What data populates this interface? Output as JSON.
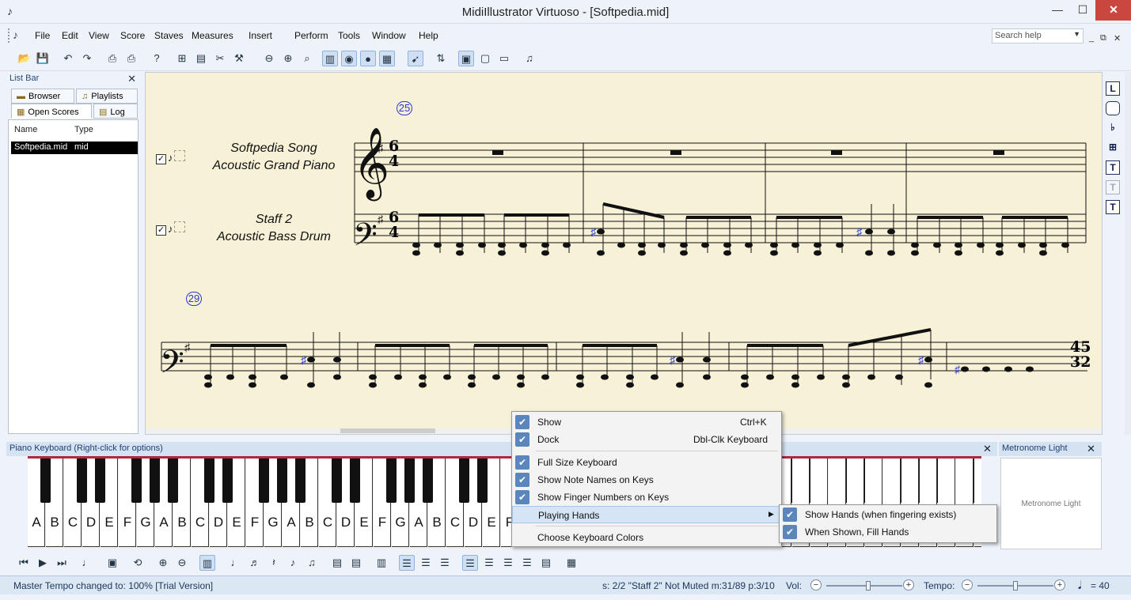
{
  "window": {
    "title": "MidiIllustrator Virtuoso - [Softpedia.mid]",
    "minimize": "—",
    "maximize": "☐",
    "close": "✕"
  },
  "menu": {
    "items": [
      "File",
      "Edit",
      "View",
      "Score",
      "Staves",
      "Measures",
      "Insert",
      "Perform",
      "Tools",
      "Window",
      "Help"
    ],
    "search_placeholder": "Search help",
    "mdi_min": "_",
    "mdi_restore": "⧉",
    "mdi_close": "✕"
  },
  "list_bar": {
    "title": "List Bar",
    "tabs": [
      "Browser",
      "Playlists",
      "Open Scores",
      "Log"
    ],
    "columns": [
      "Name",
      "Type"
    ],
    "rows": [
      {
        "name": "Softpedia.mid",
        "type": "mid"
      }
    ]
  },
  "score": {
    "measure_numbers": [
      "25",
      "29"
    ],
    "staff1_name": "Softpedia Song",
    "staff1_instrument": "Acoustic Grand Piano",
    "staff2_name": "Staff 2",
    "staff2_instrument": "Acoustic Bass Drum",
    "time_sig_top": "6",
    "time_sig_bottom": "4",
    "end_time_top": "45",
    "end_time_bottom": "32"
  },
  "keyboard_panel": {
    "title": "Piano Keyboard (Right-click for options)",
    "white_key_names": [
      "A",
      "B",
      "C",
      "D",
      "E",
      "F",
      "G",
      "A",
      "B",
      "C",
      "D",
      "E",
      "F",
      "G",
      "A",
      "B",
      "C",
      "D",
      "E",
      "F",
      "G",
      "A",
      "B",
      "C",
      "D",
      "E",
      "F"
    ]
  },
  "metronome": {
    "title": "Metronome Light",
    "label": "Metronome Light"
  },
  "context_menu": {
    "items": [
      {
        "label": "Show",
        "shortcut": "Ctrl+K",
        "checked": true
      },
      {
        "label": "Dock",
        "shortcut": "Dbl-Clk Keyboard",
        "checked": true
      },
      {
        "label": "Full Size Keyboard",
        "checked": true
      },
      {
        "label": "Show Note Names on Keys",
        "checked": true
      },
      {
        "label": "Show Finger Numbers on Keys",
        "checked": true
      },
      {
        "label": "Playing Hands",
        "submenu": true
      },
      {
        "label": "Choose Keyboard Colors"
      }
    ],
    "submenu": [
      {
        "label": "Show Hands (when fingering exists)",
        "checked": true
      },
      {
        "label": "When Shown, Fill Hands",
        "checked": true
      }
    ]
  },
  "status": {
    "message": "Master Tempo changed to: 100%  [Trial Version]",
    "staff_info": "s: 2/2 \"Staff 2\" Not Muted  m:31/89  p:3/10",
    "vol_label": "Vol:",
    "tempo_label": "Tempo:",
    "tempo_value": "= 40",
    "volume_level": 0.55,
    "tempo_level": 0.5
  },
  "colors": {
    "accent": "#2a3bd0",
    "score_bg": "#f7f1d7",
    "keyboard_top": "#b02a3c",
    "check": "#5a86bc"
  }
}
